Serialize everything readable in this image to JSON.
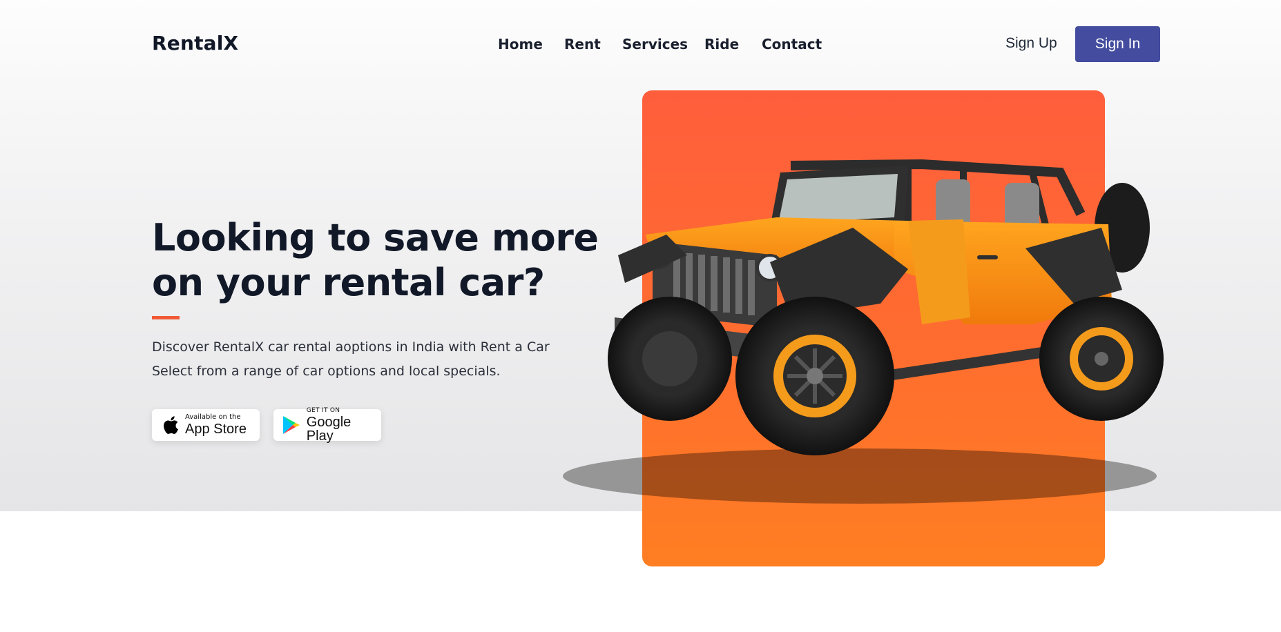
{
  "brand": {
    "name": "RentalX"
  },
  "nav": {
    "links": [
      "Home",
      "Rent",
      "Services",
      "Ride",
      "Contact"
    ],
    "signup_label": "Sign Up",
    "signin_label": "Sign In"
  },
  "hero": {
    "headline_line1": "Looking to save more",
    "headline_line2": "on your rental car?",
    "desc_line1": "Discover RentalX car rental aoptions in India with Rent a Car",
    "desc_line2": "Select from a range of car options and local specials.",
    "image_icon": "orange-jeep-icon"
  },
  "stores": {
    "apple": {
      "small": "Available on the",
      "big": "App Store",
      "icon": "apple-icon"
    },
    "google": {
      "small": "GET IT ON",
      "big": "Google Play",
      "icon": "google-play-icon"
    }
  },
  "colors": {
    "accent": "#f05a36",
    "primary_button": "#434c9e",
    "card_orange": "#ff6a31",
    "text_dark": "#111827"
  }
}
